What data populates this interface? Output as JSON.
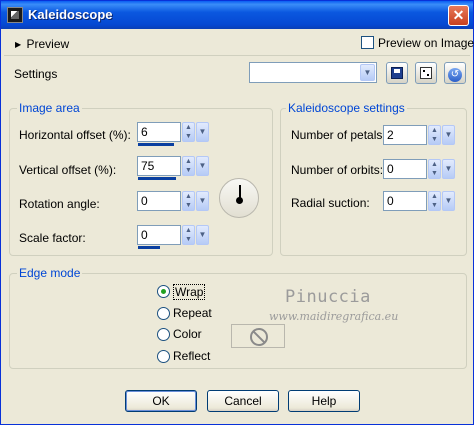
{
  "window": {
    "title": "Kaleidoscope",
    "close_symbol": "✕",
    "icon": "kaleidoscope-app-icon"
  },
  "top": {
    "preview_toggle": "Preview",
    "preview_on_image_label": "Preview on Image",
    "preview_on_image_checked": false,
    "settings_label": "Settings",
    "settings_value": "",
    "save_icon": "floppy-save-icon",
    "random_icon": "dice-randomize-icon",
    "reset_icon": "reset-undo-icon"
  },
  "image_area": {
    "title": "Image area",
    "horizontal_offset": {
      "label": "Horizontal offset (%):",
      "value": "6",
      "level": 0.8
    },
    "vertical_offset": {
      "label": "Vertical offset (%):",
      "value": "75",
      "level": 0.85
    },
    "rotation_angle": {
      "label": "Rotation angle:",
      "value": "0"
    },
    "scale_factor": {
      "label": "Scale factor:",
      "value": "0",
      "level": 0.5
    }
  },
  "kaleidoscope": {
    "title": "Kaleidoscope settings",
    "petals": {
      "label": "Number of petals:",
      "value": "2"
    },
    "orbits": {
      "label": "Number of orbits:",
      "value": "0"
    },
    "radial": {
      "label": "Radial suction:",
      "value": "0"
    }
  },
  "edge_mode": {
    "title": "Edge mode",
    "options": [
      "Wrap",
      "Repeat",
      "Color",
      "Reflect"
    ],
    "selected": "Wrap"
  },
  "watermark": {
    "name": "Pinuccia",
    "url": "www.maidiregrafica.eu"
  },
  "buttons": {
    "ok": "OK",
    "cancel": "Cancel",
    "help": "Help"
  },
  "colors": {
    "title_bar": "#0548d2",
    "group_label": "#0046d5",
    "dialog_bg": "#ece9d8"
  }
}
